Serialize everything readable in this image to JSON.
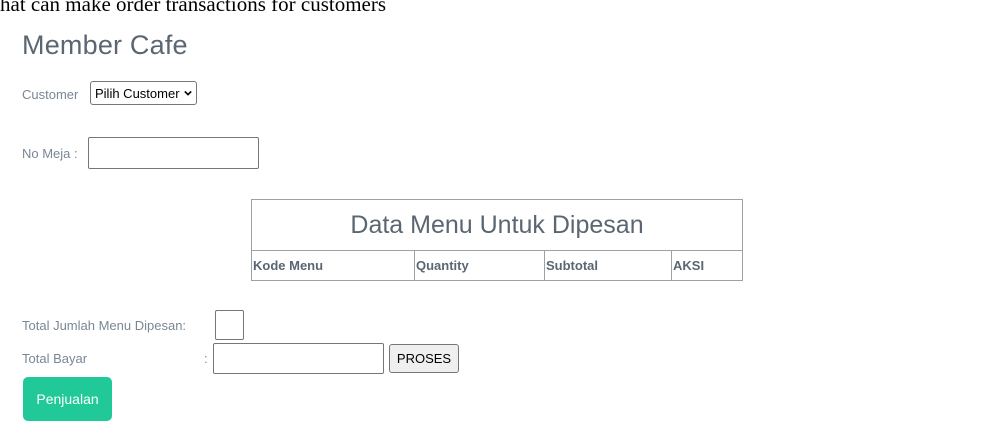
{
  "caption": "hat can make order transactions for customers",
  "page_title": "Member Cafe",
  "form": {
    "customer_label": "Customer",
    "customer_selected": "Pilih Customer",
    "no_meja_label": "No Meja :",
    "no_meja_value": "",
    "total_jumlah_label": "Total Jumlah Menu Dipesan:",
    "total_jumlah_value": "",
    "total_bayar_label": "Total Bayar",
    "total_bayar_colon": ":",
    "total_bayar_value": ""
  },
  "menu_table": {
    "title": "Data Menu Untuk Dipesan",
    "columns": [
      "Kode Menu",
      "Quantity",
      "Subtotal",
      "AKSI"
    ]
  },
  "buttons": {
    "proses": "PROSES",
    "penjualan": "Penjualan"
  },
  "colors": {
    "accent": "#20c997",
    "heading": "#5b6673",
    "label": "#7a8794"
  },
  "icons": {
    "select_arrow": "chevron-down-icon"
  }
}
